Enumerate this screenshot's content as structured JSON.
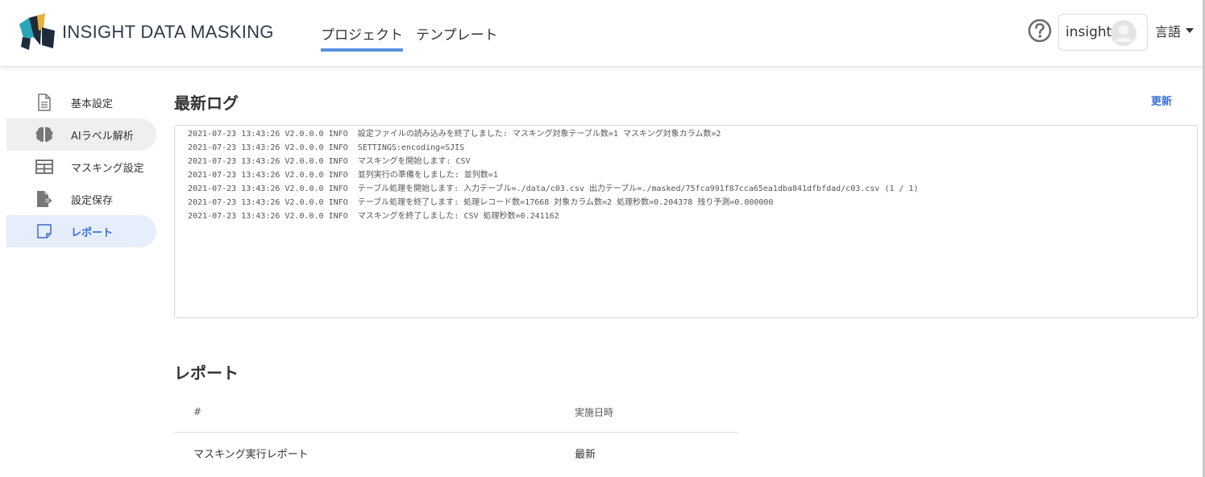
{
  "header": {
    "brand": "INSIGHT DATA MASKING",
    "nav": [
      {
        "label": "プロジェクト",
        "active": true
      },
      {
        "label": "テンプレート",
        "active": false
      }
    ],
    "user_name": "insight",
    "language_label": "言語"
  },
  "sidebar": {
    "items": [
      {
        "label": "基本設定",
        "icon": "document-icon",
        "state": "normal"
      },
      {
        "label": "AIラベル解析",
        "icon": "brain-icon",
        "state": "hover"
      },
      {
        "label": "マスキング設定",
        "icon": "table-icon",
        "state": "normal"
      },
      {
        "label": "設定保存",
        "icon": "file-export-icon",
        "state": "normal"
      },
      {
        "label": "レポート",
        "icon": "note-icon",
        "state": "active"
      }
    ]
  },
  "log_section": {
    "title": "最新ログ",
    "refresh_label": "更新",
    "lines": [
      "2021-07-23 13:43:26 V2.0.0.0 INFO  設定ファイルの読み込みを終了しました: マスキング対象テーブル数=1 マスキング対象カラム数=2",
      "2021-07-23 13:43:26 V2.0.0.0 INFO  SETTINGS:encoding=SJIS",
      "2021-07-23 13:43:26 V2.0.0.0 INFO  マスキングを開始します: CSV",
      "2021-07-23 13:43:26 V2.0.0.0 INFO  並列実行の準備をしました: 並列数=1",
      "2021-07-23 13:43:26 V2.0.0.0 INFO  テーブル処理を開始します: 入力テーブル=./data/c03.csv 出力テーブル=./masked/75fca991f87cca65ea1dba841dfbfdad/c03.csv (1 / 1)",
      "2021-07-23 13:43:26 V2.0.0.0 INFO  テーブル処理を終了します: 処理レコード数=17668 対象カラム数=2 処理秒数=0.204378 残り予測=0.000000",
      "2021-07-23 13:43:26 V2.0.0.0 INFO  マスキングを終了しました: CSV 処理秒数=0.241162"
    ]
  },
  "report_section": {
    "title": "レポート",
    "columns": [
      "#",
      "実施日時"
    ],
    "rows": [
      [
        "マスキング実行レポート",
        "最新"
      ]
    ]
  },
  "colors": {
    "accent": "#3a6fd8",
    "nav_underline": "#5b8fe0",
    "active_bg": "#e6eefb"
  }
}
